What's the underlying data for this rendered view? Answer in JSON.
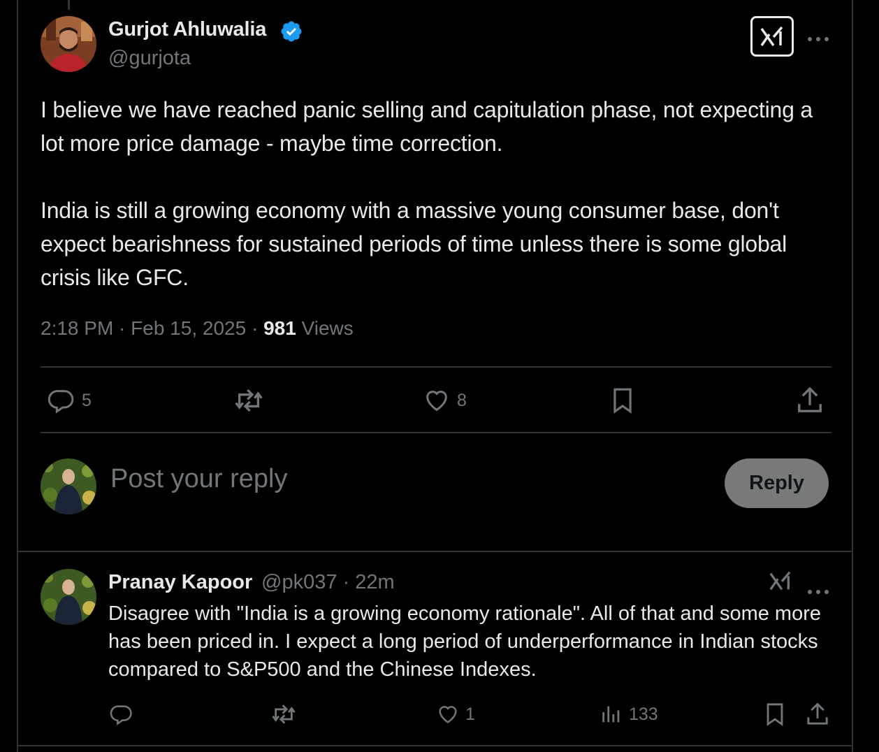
{
  "tweet": {
    "author_name": "Gurjot Ahluwalia",
    "author_handle": "@gurjota",
    "text": "I believe we have reached panic selling and capitulation phase, not expecting a lot more price damage - maybe time correction.\n\nIndia is still a growing economy with a massive young consumer base, don't expect bearishness for sustained periods of time unless there is some global crisis like GFC.",
    "timestamp": "2:18 PM · Feb 15, 2025 · ",
    "views_count": "981",
    "views_label": " Views",
    "actions": {
      "replies": "5",
      "reposts": "",
      "likes": "8"
    },
    "icons": [
      "verified-badge-icon",
      "grok-icon",
      "more-icon",
      "reply-icon",
      "repost-icon",
      "like-icon",
      "bookmark-icon",
      "share-icon"
    ]
  },
  "composer": {
    "placeholder": "Post your reply",
    "reply_button_label": "Reply"
  },
  "reply": {
    "author_name": "Pranay Kapoor",
    "author_handle": "@pk037 · 22m",
    "text": "Disagree with \"India is a growing economy rationale\". All of that and some more has been priced in. I expect a long period of underperformance in Indian stocks compared to S&P500 and the Chinese Indexes.",
    "actions": {
      "replies": "",
      "reposts": "",
      "likes": "1",
      "views": "133"
    }
  },
  "colors": {
    "background": "#000000",
    "text_primary": "#e7e9ea",
    "text_secondary": "#71767b",
    "verified": "#1d9bf0",
    "border": "#2f3336",
    "reply_button_bg": "#787a7a"
  }
}
